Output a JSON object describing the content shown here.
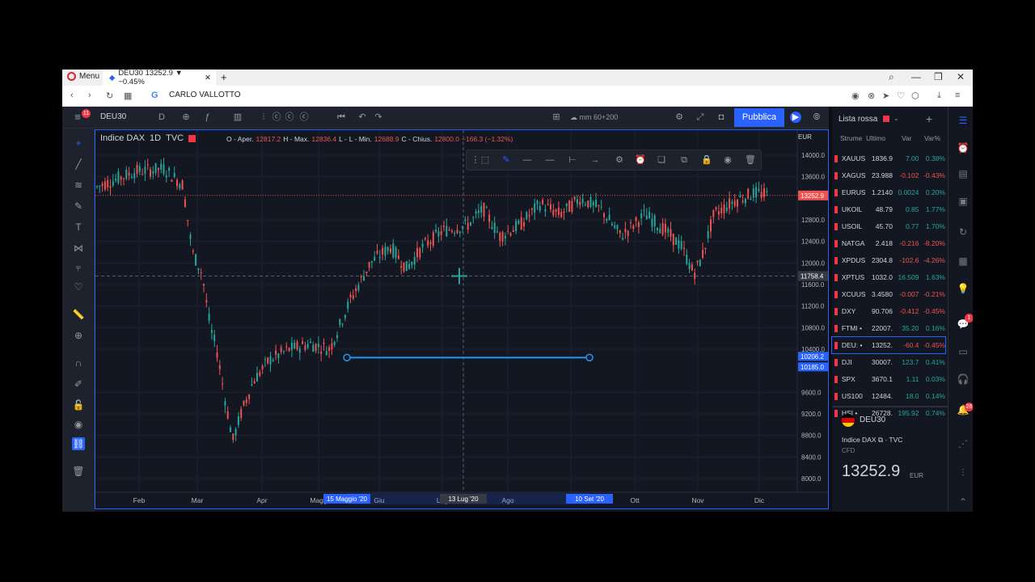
{
  "browser": {
    "menu_label": "Menu",
    "tab_title": "DEU30 13252.9 ▼ −0.45%",
    "address": "CARLO VALLOTTO"
  },
  "toolbar": {
    "symbol": "DEU30",
    "interval": "D",
    "layout_label": "mm 60+200",
    "publish_label": "Pubblica"
  },
  "left_badge": "11",
  "legend": {
    "name": "Indice DAX",
    "interval": "1D",
    "exchange": "TVC",
    "o_label": "O - Aper.",
    "o": "12817.2",
    "h_label": "H - Max.",
    "h": "12836.4",
    "l_label": "L - Min.",
    "l": "12688.9",
    "c_label": "C - Chius.",
    "c": "12800.0",
    "change": "−166.3 (−1.32%)"
  },
  "currency": "EUR",
  "chart_data": {
    "type": "candlestick",
    "y_ticks": [
      14000,
      13600,
      12800,
      12400,
      12000,
      11600,
      11200,
      10800,
      10400,
      9600,
      9200,
      8800,
      8400,
      8000
    ],
    "x_ticks": [
      "Feb",
      "Mar",
      "Apr",
      "Magg",
      "Giu",
      "Lug",
      "Ago",
      "Set",
      "Ott",
      "Nov",
      "Dic"
    ],
    "last_price": "13252.9",
    "crosshair_price": "11758.4",
    "line_price_1": "10206.2",
    "line_price_2": "10185.0",
    "x_markers": [
      "15 Maggio '20",
      "13 Lug '20",
      "10 Set '20"
    ],
    "colors": {
      "up": "#26a69a",
      "down": "#ef5350",
      "line": "#2196f3"
    }
  },
  "watchlist": {
    "title": "Lista rossa",
    "cols": [
      "Strume",
      "Ultimo",
      "Var",
      "Var%"
    ],
    "rows": [
      {
        "sym": "XAUUS",
        "last": "1836.9",
        "chg": "7.00",
        "pct": "0.38%",
        "dir": "pos"
      },
      {
        "sym": "XAGUS",
        "last": "23.988",
        "chg": "-0.102",
        "pct": "-0.43%",
        "dir": "neg"
      },
      {
        "sym": "EURUS",
        "last": "1.2140",
        "chg": "0.0024",
        "pct": "0.20%",
        "dir": "pos"
      },
      {
        "sym": "UKOIL",
        "last": "48.79",
        "chg": "0.85",
        "pct": "1.77%",
        "dir": "pos"
      },
      {
        "sym": "USOIL",
        "last": "45.70",
        "chg": "0.77",
        "pct": "1.70%",
        "dir": "pos"
      },
      {
        "sym": "NATGA",
        "last": "2.418",
        "chg": "-0.216",
        "pct": "-8.20%",
        "dir": "neg"
      },
      {
        "sym": "XPDUS",
        "last": "2304.8",
        "chg": "-102.6",
        "pct": "-4.26%",
        "dir": "neg"
      },
      {
        "sym": "XPTUS",
        "last": "1032.0",
        "chg": "16.509",
        "pct": "1.63%",
        "dir": "pos"
      },
      {
        "sym": "XCUUS",
        "last": "3.4580",
        "chg": "-0.007",
        "pct": "-0.21%",
        "dir": "neg"
      },
      {
        "sym": "DXY",
        "last": "90.706",
        "chg": "-0.412",
        "pct": "-0.45%",
        "dir": "neg"
      },
      {
        "sym": "FTMI •",
        "last": "22007.",
        "chg": "35.20",
        "pct": "0.16%",
        "dir": "pos"
      },
      {
        "sym": "DEU: •",
        "last": "13252.",
        "chg": "-60.4",
        "pct": "-0.45%",
        "dir": "neg"
      },
      {
        "sym": "DJI",
        "last": "30007.",
        "chg": "123.7",
        "pct": "0.41%",
        "dir": "pos"
      },
      {
        "sym": "SPX",
        "last": "3670.1",
        "chg": "1.11",
        "pct": "0.03%",
        "dir": "pos"
      },
      {
        "sym": "US100",
        "last": "12484.",
        "chg": "18.0",
        "pct": "0.14%",
        "dir": "pos"
      },
      {
        "sym": "HSI •",
        "last": "26728.",
        "chg": "195.92",
        "pct": "0.74%",
        "dir": "pos"
      }
    ]
  },
  "detail": {
    "symbol": "DEU30",
    "name": "Indice DAX",
    "source": "TVC",
    "type": "CFD",
    "price": "13252.9",
    "currency": "EUR"
  },
  "right_badges": [
    "1",
    "26"
  ]
}
